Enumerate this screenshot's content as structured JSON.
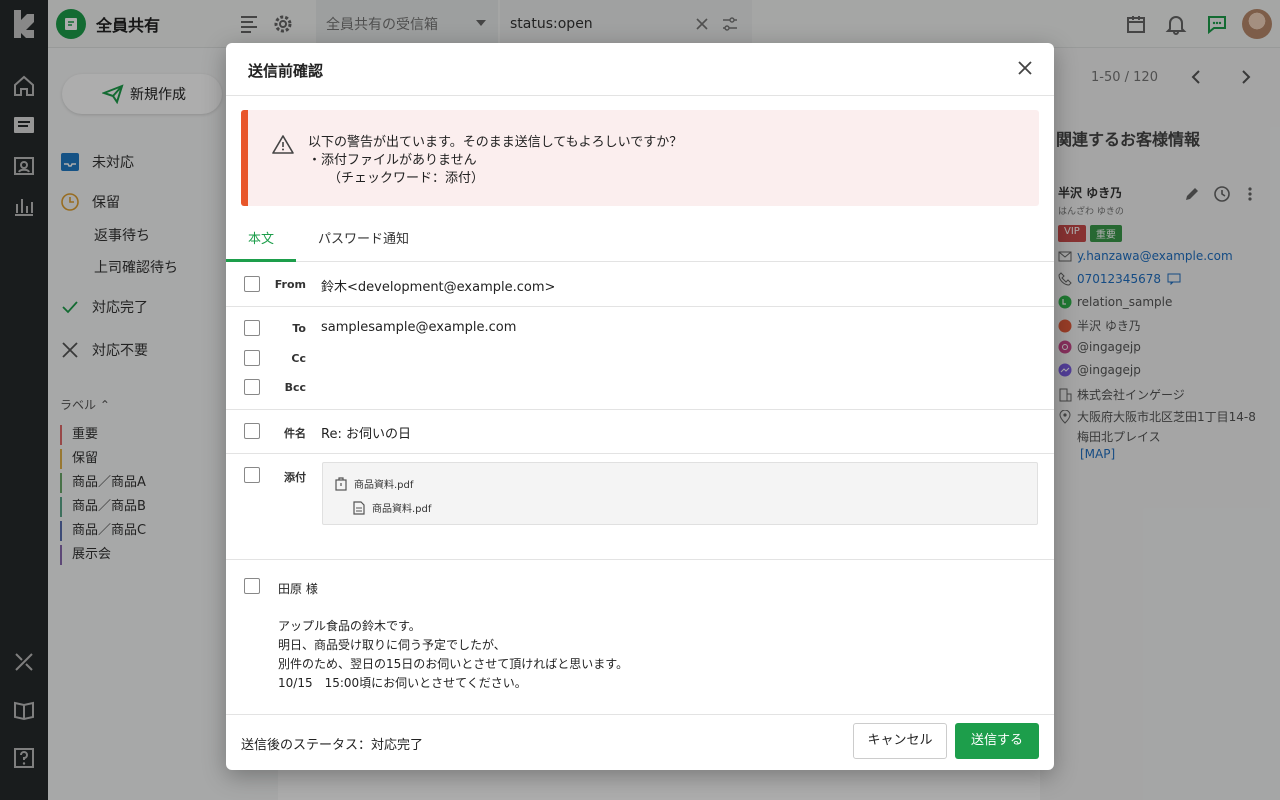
{
  "topbar": {
    "team_name": "全員共有",
    "inbox_select": "全員共有の受信箱",
    "search_query": "status:open"
  },
  "sidebar": {
    "compose_label": "新規作成",
    "items": [
      {
        "label": "未対応"
      },
      {
        "label": "保留"
      },
      {
        "label": "返事待ち"
      },
      {
        "label": "上司確認待ち"
      },
      {
        "label": "対応完了"
      },
      {
        "label": "対応不要"
      }
    ],
    "labels_header": "ラベル",
    "labels": [
      {
        "label": "重要",
        "color": "#e06a6a"
      },
      {
        "label": "保留",
        "color": "#e0b24a"
      },
      {
        "label": "商品／商品A",
        "color": "#6aa86a"
      },
      {
        "label": "商品／商品B",
        "color": "#5aa58a"
      },
      {
        "label": "商品／商品C",
        "color": "#5a6fb0"
      },
      {
        "label": "展示会",
        "color": "#8a6ab0"
      }
    ]
  },
  "right_panel": {
    "count": "1-50 / 120",
    "title": "関連するお客様情報",
    "customer_name": "半沢 ゆき乃",
    "customer_kana": "はんざわ ゆきの",
    "tags": [
      "VIP",
      "重要"
    ],
    "email": "y.hanzawa@example.com",
    "phone": "07012345678",
    "line": "relation_sample",
    "cw": "半沢 ゆき乃",
    "instagram": "@ingagejp",
    "messenger": "@ingagejp",
    "company": "株式会社インゲージ",
    "address_line1": "大阪府大阪市北区芝田1丁目14-8",
    "address_line2": "梅田北プレイス",
    "map_link": "[MAP]"
  },
  "modal": {
    "title": "送信前確認",
    "alert": {
      "line1": "以下の警告が出ています。そのまま送信してもよろしいですか？",
      "line2": "・添付ファイルがありません",
      "line3": "（チェックワード：添付）"
    },
    "tabs": [
      {
        "label": "本文"
      },
      {
        "label": "パスワード通知"
      }
    ],
    "fields": {
      "from_label": "From",
      "from_value": "鈴木<development@example.com>",
      "to_label": "To",
      "to_value": "samplesample@example.com",
      "cc_label": "Cc",
      "bcc_label": "Bcc",
      "subject_label": "件名",
      "subject_value": "Re: お伺いの日",
      "attach_label": "添付",
      "attachments": [
        "商品資料.pdf",
        "商品資料.pdf"
      ]
    },
    "body": {
      "greeting": "田原 様",
      "lines": [
        "アップル食品の鈴木です。",
        "明日、商品受け取りに伺う予定でしたが、",
        "別件のため、翌日の15日のお伺いとさせて頂ければと思います。",
        "10/15　15:00頃にお伺いとさせてください。"
      ]
    },
    "footer": {
      "status": "送信後のステータス：対応完了",
      "cancel": "キャンセル",
      "send": "送信する"
    }
  }
}
